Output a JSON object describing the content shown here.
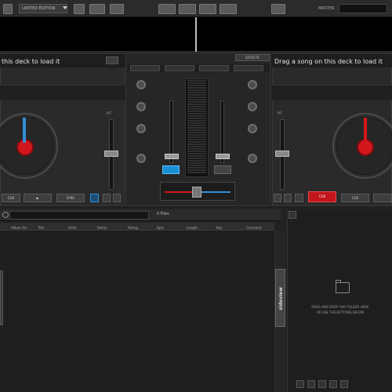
{
  "topbar": {
    "skin_select": "LIMITED EDITION",
    "master_label": "MASTER"
  },
  "left_deck": {
    "title": "this deck to load it",
    "cue_label": "CUE",
    "play_label": "▶",
    "sync_label": "SYNC",
    "pitch_label": "PIT",
    "platter_color": "#d2171c",
    "marker_color": "#2f8fd8"
  },
  "right_deck": {
    "title": "Drag a song on this deck to load it",
    "play_label": "CUE",
    "cue_label": "CUE",
    "pitch_label": "PIT",
    "platter_color": "#d2171c",
    "marker_color": "#d2171c"
  },
  "mixer": {
    "effects_label": "EFFECTS",
    "crossfader_position": 0.48
  },
  "browser": {
    "search_placeholder": "",
    "file_count": "0 Files",
    "columns": [
      "Album Art",
      "Title",
      "Artist",
      "Remix",
      "Rating",
      "Bpm",
      "Length",
      "Key",
      "Comment"
    ],
    "sideview_label": "sideview",
    "empty_text": [
      "DRAG AND DROP ANY FOLDER HERE",
      "OR USE THE BUTTONS BELOW"
    ]
  },
  "colors": {
    "accent_red": "#d2171c",
    "accent_blue": "#2f8fd8",
    "panel": "#2a2a2a"
  }
}
